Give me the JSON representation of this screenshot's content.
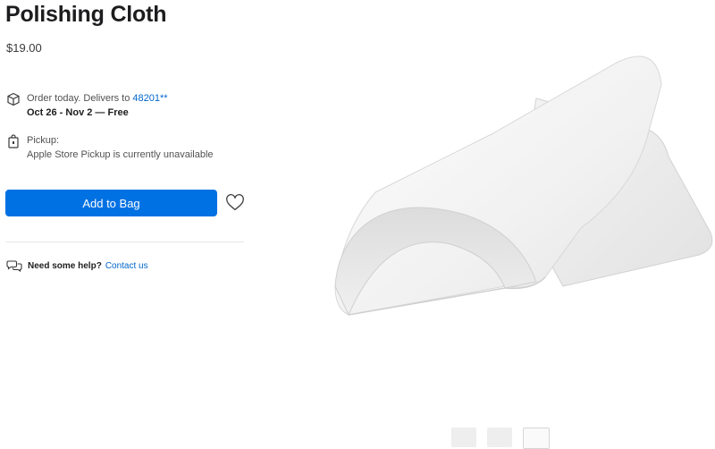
{
  "product": {
    "title": "Polishing Cloth",
    "price": "$19.00"
  },
  "delivery": {
    "prefix": "Order today. Delivers to ",
    "zip": "48201**",
    "dates": "Oct 26 - Nov 2 — Free"
  },
  "pickup": {
    "label": "Pickup:",
    "status": "Apple Store Pickup is currently unavailable"
  },
  "actions": {
    "add_to_bag": "Add to Bag"
  },
  "help": {
    "question": "Need some help?",
    "link": "Contact us"
  },
  "colors": {
    "accent": "#0071e3",
    "link": "#0066cc"
  },
  "icons": [
    "box-icon",
    "store-bag-icon",
    "heart-icon",
    "chat-bubbles-icon"
  ]
}
